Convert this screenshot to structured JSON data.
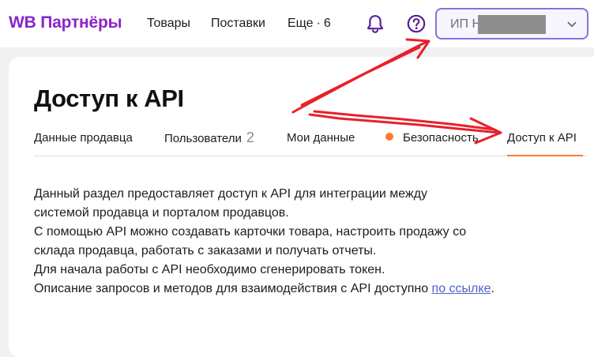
{
  "header": {
    "logo": "WB Партнёры",
    "nav": [
      {
        "label": "Товары"
      },
      {
        "label": "Поставки"
      },
      {
        "label": "Еще",
        "sep": "·",
        "count": "6"
      }
    ],
    "account": {
      "label": "ИП Н… …а…"
    }
  },
  "page": {
    "title": "Доступ к API",
    "tabs": [
      {
        "label": "Данные продавца"
      },
      {
        "label": "Пользователи",
        "count": "2"
      },
      {
        "label": "Мои данные"
      },
      {
        "label": "Безопасность"
      },
      {
        "label": "Доступ к API"
      }
    ],
    "body": {
      "line1": "Данный раздел предоставляет доступ к API для интеграции между",
      "line2": "системой продавца и порталом продавцов.",
      "line3": "С помощью API можно создавать карточки товара, настроить продажу со",
      "line4": "склада продавца, работать с заказами и получать отчеты.",
      "line5": "Для начала работы с API необходимо сгенерировать токен.",
      "line6": "Описание запросов и методов для взаимодействия с API доступно ",
      "link": "по ссылке",
      "after_link": "."
    }
  },
  "colors": {
    "brand": "#8a24c8",
    "accent": "#ff7a2f",
    "link": "#4f5fc8",
    "annotation": "#e8202a"
  },
  "icons": {
    "bell": "bell-icon",
    "help": "help-icon",
    "chevron": "chevron-down-icon"
  }
}
